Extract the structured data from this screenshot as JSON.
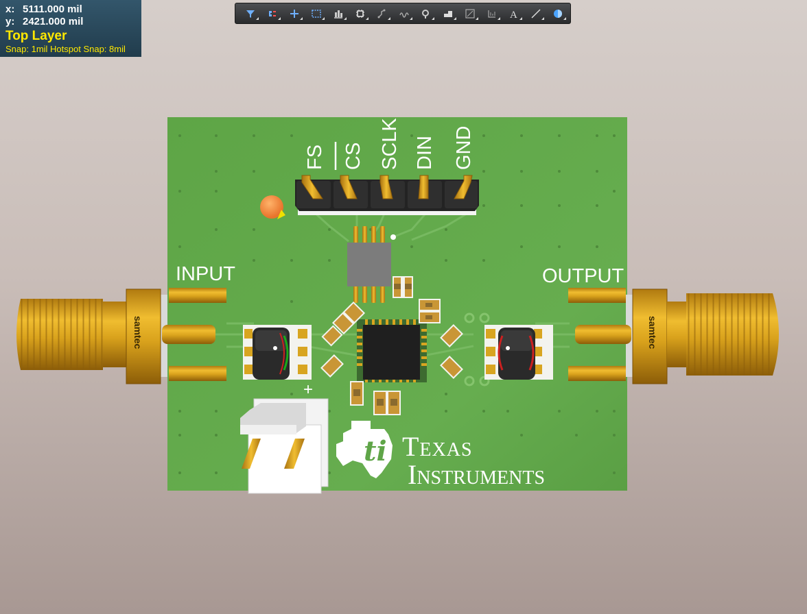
{
  "hud": {
    "x_label": "x:",
    "x_value": "5111.000 mil",
    "y_label": "y:",
    "y_value": "2421.000 mil",
    "layer": "Top Layer",
    "snap": "Snap: 1mil Hotspot Snap: 8mil"
  },
  "toolbar": {
    "tools": [
      "filter-icon",
      "interactive-routing-icon",
      "cross-select-icon",
      "select-area-icon",
      "align-icon",
      "component-icon",
      "route-icon",
      "differential-pair-icon",
      "place-pad-icon",
      "place-via-icon",
      "place-polygon-icon",
      "measure-icon",
      "text-icon",
      "line-icon",
      "dimension-icon"
    ]
  },
  "board": {
    "header_labels": [
      "FS",
      "CS",
      "SCLK",
      "DIN",
      "GND"
    ],
    "input_label": "INPUT",
    "output_label": "OUTPUT",
    "plus_label": "+",
    "connector_brand": "samtec",
    "logo_line1": "Texas",
    "logo_line2": "Instruments",
    "colors": {
      "pcb": "#5fa548",
      "copper": "#d8a520",
      "silk": "#ffffff",
      "ic": "#1e1e1e"
    }
  }
}
